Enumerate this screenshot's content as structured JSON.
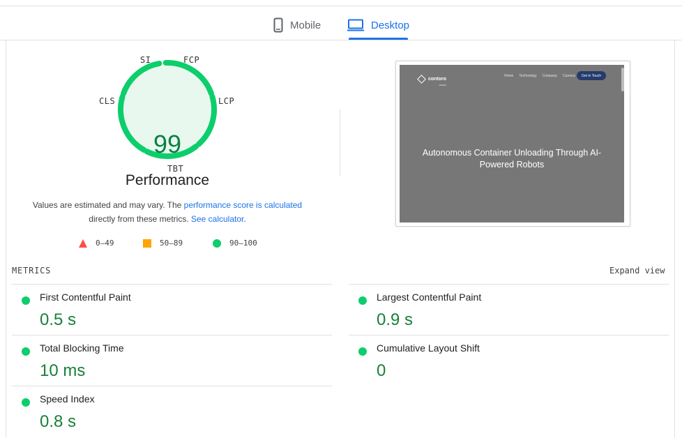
{
  "tabs": [
    {
      "label": "Mobile",
      "icon": "phone-icon",
      "active": false
    },
    {
      "label": "Desktop",
      "icon": "laptop-icon",
      "active": true
    }
  ],
  "gauge": {
    "score": "99",
    "labels": {
      "si": "SI",
      "fcp": "FCP",
      "lcp": "LCP",
      "tbt": "TBT",
      "cls": "CLS"
    },
    "title": "Performance",
    "color": "#0cce6b",
    "fill": "#e8f8ef"
  },
  "note": {
    "prefix": "Values are estimated and may vary. The ",
    "link1": "performance score is calculated",
    "middle": " directly from these metrics. ",
    "link2": "See calculator",
    "suffix": "."
  },
  "legend": [
    {
      "range": "0–49",
      "shape": "triangle",
      "color": "#ff4e42"
    },
    {
      "range": "50–89",
      "shape": "square",
      "color": "#ffa400"
    },
    {
      "range": "90–100",
      "shape": "circle",
      "color": "#0cce6b"
    }
  ],
  "screenshot": {
    "brand": "contoro",
    "brand_sub": "robotics",
    "nav": [
      "Home",
      "Technology",
      "Company",
      "Careers"
    ],
    "cta": "Get in Touch",
    "hero": "Autonomous Container Unloading Through AI-Powered Robots"
  },
  "metrics": {
    "title": "METRICS",
    "expand": "Expand view",
    "items": [
      {
        "name": "First Contentful Paint",
        "value": "0.5 s",
        "status_color": "#0cce6b"
      },
      {
        "name": "Largest Contentful Paint",
        "value": "0.9 s",
        "status_color": "#0cce6b"
      },
      {
        "name": "Total Blocking Time",
        "value": "10 ms",
        "status_color": "#0cce6b"
      },
      {
        "name": "Cumulative Layout Shift",
        "value": "0",
        "status_color": "#0cce6b"
      },
      {
        "name": "Speed Index",
        "value": "0.8 s",
        "status_color": "#0cce6b"
      }
    ]
  }
}
